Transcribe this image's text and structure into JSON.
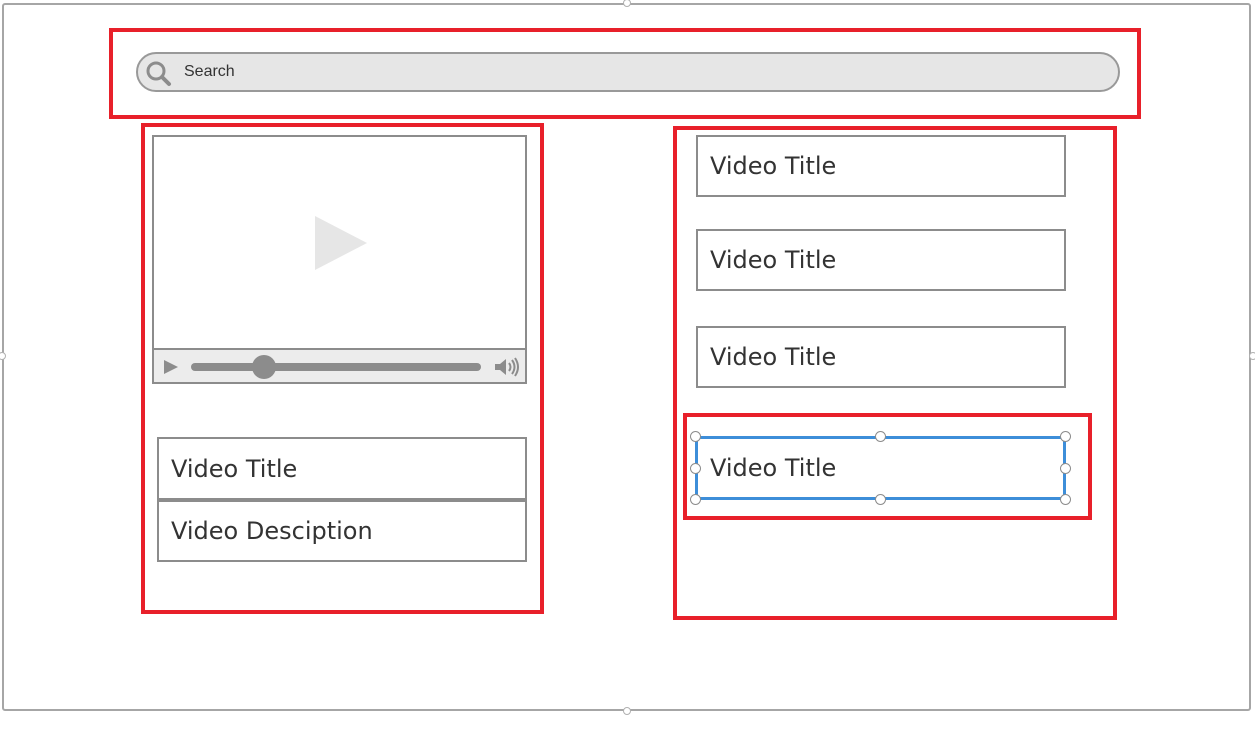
{
  "search": {
    "placeholder": "Search"
  },
  "player": {
    "title": "Video Title",
    "description": "Video Desciption",
    "progress": 0.25
  },
  "video_list": [
    {
      "title": "Video Title"
    },
    {
      "title": "Video Title"
    },
    {
      "title": "Video Title"
    },
    {
      "title": "Video Title"
    }
  ],
  "colors": {
    "annotation_red": "#e8202a",
    "selection_blue": "#3d8ed9",
    "wireframe_gray": "#8c8c8c"
  },
  "icons": [
    "search-icon",
    "play-icon",
    "volume-icon"
  ]
}
